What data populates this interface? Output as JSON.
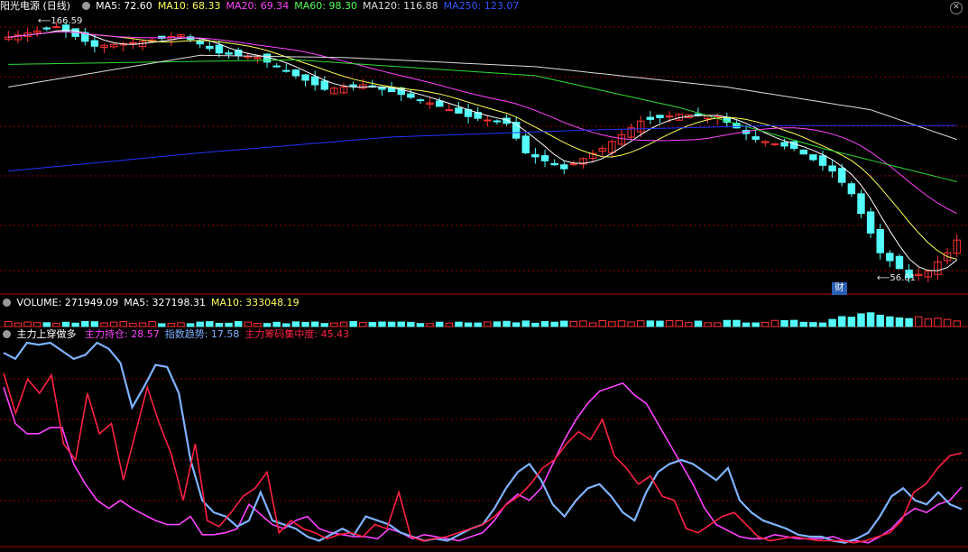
{
  "header": {
    "stock_title": "阳光电源 (日线)",
    "ma_items": [
      {
        "label": "MA5: 72.60",
        "color": "#ffffff"
      },
      {
        "label": "MA10: 68.33",
        "color": "#ffff55"
      },
      {
        "label": "MA20: 69.34",
        "color": "#ff44ff"
      },
      {
        "label": "MA60: 98.30",
        "color": "#55ff55"
      },
      {
        "label": "MA120: 116.88",
        "color": "#dddddd"
      },
      {
        "label": "MA250: 123.07",
        "color": "#3355ff"
      }
    ],
    "close_glyph": "✕"
  },
  "volume_header": {
    "items": [
      {
        "label": "VOLUME: 271949.09",
        "color": "#ffffff"
      },
      {
        "label": "MA5: 327198.31",
        "color": "#ffffff"
      },
      {
        "label": "MA10: 333048.19",
        "color": "#ffff55"
      }
    ]
  },
  "indicator_header": {
    "title": "主力上穿做多",
    "items": [
      {
        "label": "主力持仓: 28.57",
        "color": "#ff44ff"
      },
      {
        "label": "指数趋势: 17.58",
        "color": "#7fb2ff"
      },
      {
        "label": "主力筹码集中度: 45.43",
        "color": "#ff2244"
      }
    ]
  },
  "annotations": {
    "high_label": "166.59",
    "low_label": "56.01",
    "finance_badge": "财"
  },
  "colors": {
    "up_candle": "#ff3232",
    "down_candle": "#54fcfc",
    "grid": "#8b0000",
    "ma5": "#ffffff",
    "ma10": "#ffff55",
    "ma20": "#ff44ff",
    "ma60": "#33dd33",
    "ma120": "#dddddd",
    "ma250": "#2233ff",
    "ind_holding": "#ff44ff",
    "ind_trend": "#7fb2ff",
    "ind_conc": "#ff2244"
  },
  "chart_data": [
    {
      "type": "candlestick",
      "x_count": 100,
      "price_range": [
        50,
        172
      ],
      "price_anchors": [
        [
          0,
          162
        ],
        [
          5,
          166.59
        ],
        [
          9,
          158
        ],
        [
          14,
          160
        ],
        [
          18,
          163
        ],
        [
          22,
          155
        ],
        [
          26,
          153
        ],
        [
          30,
          145
        ],
        [
          33,
          139
        ],
        [
          37,
          141
        ],
        [
          40,
          138
        ],
        [
          44,
          133
        ],
        [
          48,
          127
        ],
        [
          52,
          124
        ],
        [
          54,
          111
        ],
        [
          58,
          104
        ],
        [
          62,
          113
        ],
        [
          66,
          125
        ],
        [
          70,
          128
        ],
        [
          74,
          127
        ],
        [
          78,
          117
        ],
        [
          82,
          113
        ],
        [
          86,
          103
        ],
        [
          88,
          93
        ],
        [
          91,
          67
        ],
        [
          93,
          60
        ],
        [
          94,
          56.01
        ],
        [
          96,
          59
        ],
        [
          98,
          67
        ],
        [
          99,
          72.6
        ]
      ],
      "moving_averages": [
        {
          "name": "MA5",
          "last": 72.6
        },
        {
          "name": "MA10",
          "last": 68.33
        },
        {
          "name": "MA20",
          "last": 69.34
        },
        {
          "name": "MA60",
          "last": 98.3,
          "anchors": [
            [
              0,
              150
            ],
            [
              30,
              152
            ],
            [
              55,
              145
            ],
            [
              70,
              131
            ],
            [
              85,
              113
            ],
            [
              99,
              98.3
            ]
          ]
        },
        {
          "name": "MA120",
          "last": 116.88,
          "anchors": [
            [
              0,
              140
            ],
            [
              20,
              154
            ],
            [
              35,
              153
            ],
            [
              55,
              149
            ],
            [
              75,
              140
            ],
            [
              90,
              130
            ],
            [
              99,
              116.88
            ]
          ]
        },
        {
          "name": "MA250",
          "last": 123.07,
          "anchors": [
            [
              0,
              103
            ],
            [
              20,
              111
            ],
            [
              40,
              118
            ],
            [
              60,
              121
            ],
            [
              80,
              123
            ],
            [
              99,
              123.07
            ]
          ]
        }
      ],
      "high": 166.59,
      "low": 56.01
    },
    {
      "type": "bar",
      "series": "VOLUME",
      "last": 271949.09,
      "ma5": 327198.31,
      "ma10": 333048.19,
      "anchors": [
        [
          0,
          200000
        ],
        [
          40,
          190000
        ],
        [
          60,
          230000
        ],
        [
          85,
          240000
        ],
        [
          89,
          700000
        ],
        [
          92,
          650000
        ],
        [
          96,
          380000
        ],
        [
          99,
          271949.09
        ]
      ]
    },
    {
      "type": "line",
      "y_range": [
        0,
        100
      ],
      "series": [
        {
          "name": "主力持仓",
          "last": 28.57,
          "values": [
            78,
            60,
            55,
            55,
            58,
            58,
            40,
            30,
            22,
            18,
            22,
            18,
            15,
            12,
            10,
            10,
            14,
            5,
            5,
            6,
            8,
            20,
            15,
            10,
            8,
            12,
            14,
            8,
            6,
            5,
            4,
            4,
            3,
            8,
            6,
            3,
            5,
            4,
            3,
            2,
            4,
            6,
            12,
            20,
            25,
            22,
            28,
            40,
            52,
            62,
            70,
            76,
            78,
            80,
            74,
            70,
            60,
            50,
            40,
            30,
            18,
            10,
            7,
            4,
            3,
            3,
            5,
            4,
            3,
            3,
            3,
            4,
            2,
            2,
            1,
            4,
            8,
            14,
            18,
            16,
            20,
            22,
            28.57
          ]
        },
        {
          "name": "指数趋势",
          "last": 17.58,
          "values": [
            95,
            92,
            100,
            99,
            100,
            96,
            92,
            94,
            100,
            97,
            90,
            68,
            78,
            89,
            88,
            75,
            42,
            22,
            16,
            14,
            9,
            12,
            26,
            12,
            10,
            8,
            4,
            2,
            5,
            8,
            5,
            14,
            12,
            10,
            6,
            4,
            2,
            3,
            2,
            5,
            8,
            10,
            18,
            28,
            36,
            40,
            32,
            20,
            14,
            22,
            28,
            30,
            24,
            16,
            12,
            26,
            36,
            40,
            42,
            40,
            36,
            32,
            38,
            22,
            16,
            12,
            10,
            8,
            5,
            4,
            4,
            2,
            1,
            3,
            6,
            14,
            24,
            28,
            22,
            20,
            26,
            20,
            17.58
          ]
        },
        {
          "name": "主力筹码集中度",
          "last": 45.43,
          "values": [
            85,
            65,
            82,
            75,
            84,
            50,
            42,
            75,
            55,
            60,
            32,
            55,
            78,
            60,
            45,
            22,
            50,
            12,
            9,
            16,
            24,
            28,
            36,
            6,
            12,
            8,
            6,
            3,
            5,
            6,
            4,
            10,
            8,
            26,
            4,
            2,
            3,
            4,
            6,
            8,
            10,
            14,
            20,
            24,
            30,
            38,
            42,
            50,
            56,
            52,
            62,
            44,
            38,
            30,
            34,
            24,
            22,
            8,
            6,
            10,
            14,
            16,
            10,
            4,
            2,
            3,
            4,
            3,
            2,
            2,
            2,
            1,
            2,
            4,
            6,
            12,
            26,
            30,
            38,
            44,
            45.43
          ]
        }
      ]
    }
  ]
}
